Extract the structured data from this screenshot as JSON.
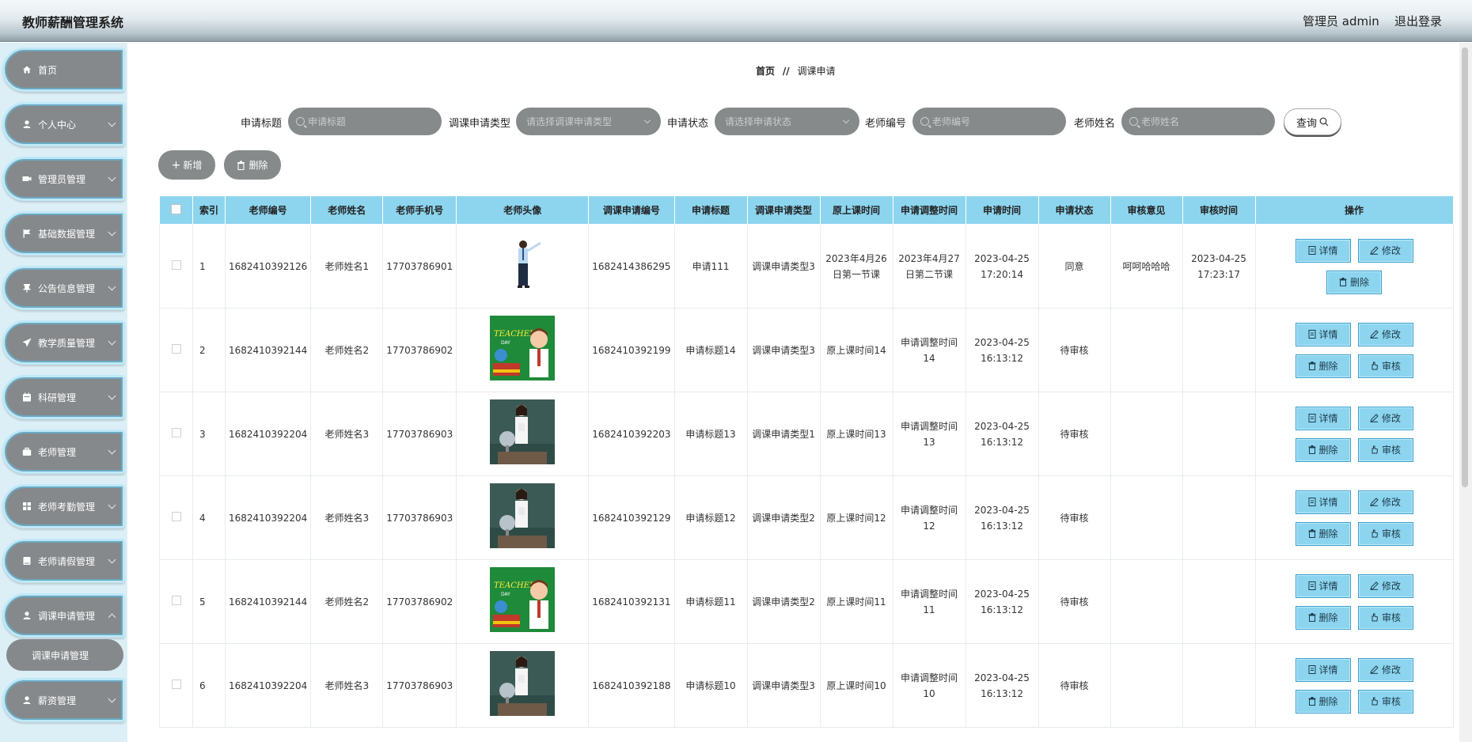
{
  "header": {
    "title": "教师薪酬管理系统",
    "admin": "管理员 admin",
    "logout": "退出登录"
  },
  "sidebar": {
    "items": [
      {
        "label": "首页"
      },
      {
        "label": "个人中心"
      },
      {
        "label": "管理员管理"
      },
      {
        "label": "基础数据管理"
      },
      {
        "label": "公告信息管理"
      },
      {
        "label": "教学质量管理"
      },
      {
        "label": "科研管理"
      },
      {
        "label": "老师管理"
      },
      {
        "label": "老师考勤管理"
      },
      {
        "label": "老师请假管理"
      },
      {
        "label": "调课申请管理"
      },
      {
        "label": "薪资管理"
      }
    ],
    "submenu": "调课申请管理"
  },
  "breadcrumb": {
    "home": "首页",
    "sep": "//",
    "current": "调课申请"
  },
  "search": {
    "title_label": "申请标题",
    "title_placeholder": "申请标题",
    "type_label": "调课申请类型",
    "type_placeholder": "请选择调课申请类型",
    "status_label": "申请状态",
    "status_placeholder": "请选择申请状态",
    "no_label": "老师编号",
    "no_placeholder": "老师编号",
    "name_label": "老师姓名",
    "name_placeholder": "老师姓名",
    "query": "查询"
  },
  "actions": {
    "add": "新增",
    "delete": "删除"
  },
  "table": {
    "headers": [
      "索引",
      "老师编号",
      "老师姓名",
      "老师手机号",
      "老师头像",
      "调课申请编号",
      "申请标题",
      "调课申请类型",
      "原上课时间",
      "申请调整时间",
      "申请时间",
      "申请状态",
      "审核意见",
      "审核时间",
      "操作"
    ],
    "ops": {
      "detail": "详情",
      "edit": "修改",
      "delete": "删除",
      "audit": "审核"
    },
    "rows": [
      {
        "idx": "1",
        "no": "1682410392126",
        "name": "老师姓名1",
        "phone": "17703786901",
        "avatar": "standing",
        "appno": "1682414386295",
        "title": "申请111",
        "type": "调课申请类型3",
        "orig": "2023年4月26日第一节课",
        "adj": "2023年4月27日第二节课",
        "time": "2023-04-25 17:20:14",
        "status": "同意",
        "opinion": "呵呵哈哈哈",
        "audit_time": "2023-04-25 17:23:17"
      },
      {
        "idx": "2",
        "no": "1682410392144",
        "name": "老师姓名2",
        "phone": "17703786902",
        "avatar": "teachers-day",
        "appno": "1682410392199",
        "title": "申请标题14",
        "type": "调课申请类型3",
        "orig": "原上课时间14",
        "adj": "申请调整时间14",
        "time": "2023-04-25 16:13:12",
        "status": "待审核",
        "opinion": "",
        "audit_time": ""
      },
      {
        "idx": "3",
        "no": "1682410392204",
        "name": "老师姓名3",
        "phone": "17703786903",
        "avatar": "classroom",
        "appno": "1682410392203",
        "title": "申请标题13",
        "type": "调课申请类型1",
        "orig": "原上课时间13",
        "adj": "申请调整时间13",
        "time": "2023-04-25 16:13:12",
        "status": "待审核",
        "opinion": "",
        "audit_time": ""
      },
      {
        "idx": "4",
        "no": "1682410392204",
        "name": "老师姓名3",
        "phone": "17703786903",
        "avatar": "classroom",
        "appno": "1682410392129",
        "title": "申请标题12",
        "type": "调课申请类型2",
        "orig": "原上课时间12",
        "adj": "申请调整时间12",
        "time": "2023-04-25 16:13:12",
        "status": "待审核",
        "opinion": "",
        "audit_time": ""
      },
      {
        "idx": "5",
        "no": "1682410392144",
        "name": "老师姓名2",
        "phone": "17703786902",
        "avatar": "teachers-day",
        "appno": "1682410392131",
        "title": "申请标题11",
        "type": "调课申请类型2",
        "orig": "原上课时间11",
        "adj": "申请调整时间11",
        "time": "2023-04-25 16:13:12",
        "status": "待审核",
        "opinion": "",
        "audit_time": ""
      },
      {
        "idx": "6",
        "no": "1682410392204",
        "name": "老师姓名3",
        "phone": "17703786903",
        "avatar": "classroom",
        "appno": "1682410392188",
        "title": "申请标题10",
        "type": "调课申请类型3",
        "orig": "原上课时间10",
        "adj": "申请调整时间10",
        "time": "2023-04-25 16:13:12",
        "status": "待审核",
        "opinion": "",
        "audit_time": ""
      }
    ]
  },
  "colors": {
    "header_col": "#8dd5ef",
    "sidebar_bg": "#dceff6",
    "menu_bg": "#86898b",
    "op_btn": "#8dd5ef"
  }
}
